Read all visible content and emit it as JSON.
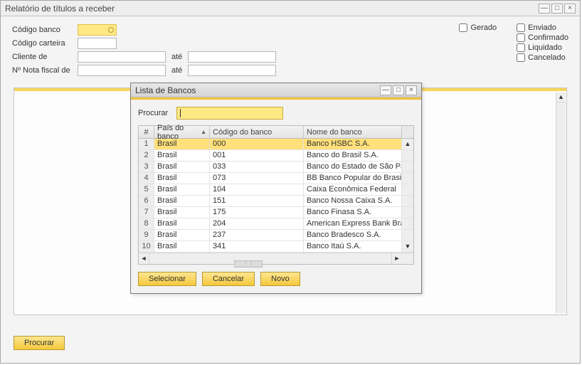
{
  "window": {
    "title": "Relatório de títulos a receber"
  },
  "form": {
    "labels": {
      "codigo_banco": "Código banco",
      "codigo_carteira": "Código carteira",
      "cliente_de": "Cliente de",
      "nota_fiscal_de": "Nº Nota fiscal de",
      "ate": "até"
    },
    "checks": {
      "gerado": "Gerado",
      "enviado": "Enviado",
      "confirmado": "Confirmado",
      "liquidado": "Liquidado",
      "cancelado": "Cancelado"
    }
  },
  "procurar_btn": "Procurar",
  "dialog": {
    "title": "Lista de Bancos",
    "search_label": "Procurar",
    "headers": {
      "num": "#",
      "pais": "País do banco",
      "codigo": "Código do banco",
      "nome": "Nome do banco"
    },
    "rows": [
      {
        "n": "1",
        "pais": "Brasil",
        "codigo": "000",
        "nome": "Banco HSBC S.A."
      },
      {
        "n": "2",
        "pais": "Brasil",
        "codigo": "001",
        "nome": "Banco do Brasil S.A."
      },
      {
        "n": "3",
        "pais": "Brasil",
        "codigo": "033",
        "nome": "Banco do Estado de São Paulo"
      },
      {
        "n": "4",
        "pais": "Brasil",
        "codigo": "073",
        "nome": "BB Banco Popular do Brasil S.A"
      },
      {
        "n": "5",
        "pais": "Brasil",
        "codigo": "104",
        "nome": "Caixa Econômica Federal"
      },
      {
        "n": "6",
        "pais": "Brasil",
        "codigo": "151",
        "nome": "Banco Nossa Caixa S.A."
      },
      {
        "n": "7",
        "pais": "Brasil",
        "codigo": "175",
        "nome": "Banco Finasa S.A."
      },
      {
        "n": "8",
        "pais": "Brasil",
        "codigo": "204",
        "nome": "American Express Bank Brasil B"
      },
      {
        "n": "9",
        "pais": "Brasil",
        "codigo": "237",
        "nome": "Banco Bradesco S.A."
      },
      {
        "n": "10",
        "pais": "Brasil",
        "codigo": "341",
        "nome": "Banco Itaú S.A."
      }
    ],
    "buttons": {
      "selecionar": "Selecionar",
      "cancelar": "Cancelar",
      "novo": "Novo"
    }
  }
}
